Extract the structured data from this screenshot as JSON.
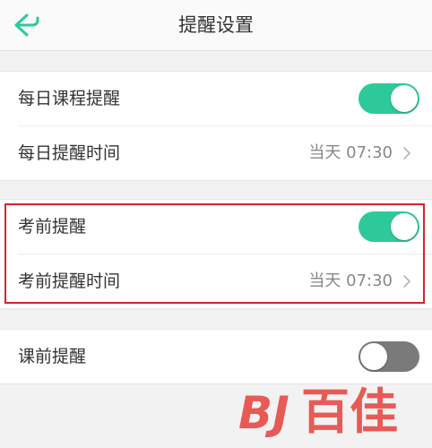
{
  "header": {
    "title": "提醒设置",
    "back_icon": "back-arrow-icon"
  },
  "colors": {
    "accent": "#2ec99a",
    "toggle_off": "#7a7a7a",
    "highlight": "#d8232a",
    "watermark": "#e84a45"
  },
  "groups": [
    {
      "rows": [
        {
          "label": "每日课程提醒",
          "type": "toggle",
          "on": true
        },
        {
          "label": "每日提醒时间",
          "type": "value",
          "value": "当天 07:30"
        }
      ]
    },
    {
      "rows": [
        {
          "label": "考前提醒",
          "type": "toggle",
          "on": true
        },
        {
          "label": "考前提醒时间",
          "type": "value",
          "value": "当天 07:30"
        }
      ]
    },
    {
      "rows": [
        {
          "label": "课前提醒",
          "type": "toggle",
          "on": false
        }
      ]
    }
  ],
  "watermark": {
    "text": "百佳",
    "logo": "BJ"
  }
}
